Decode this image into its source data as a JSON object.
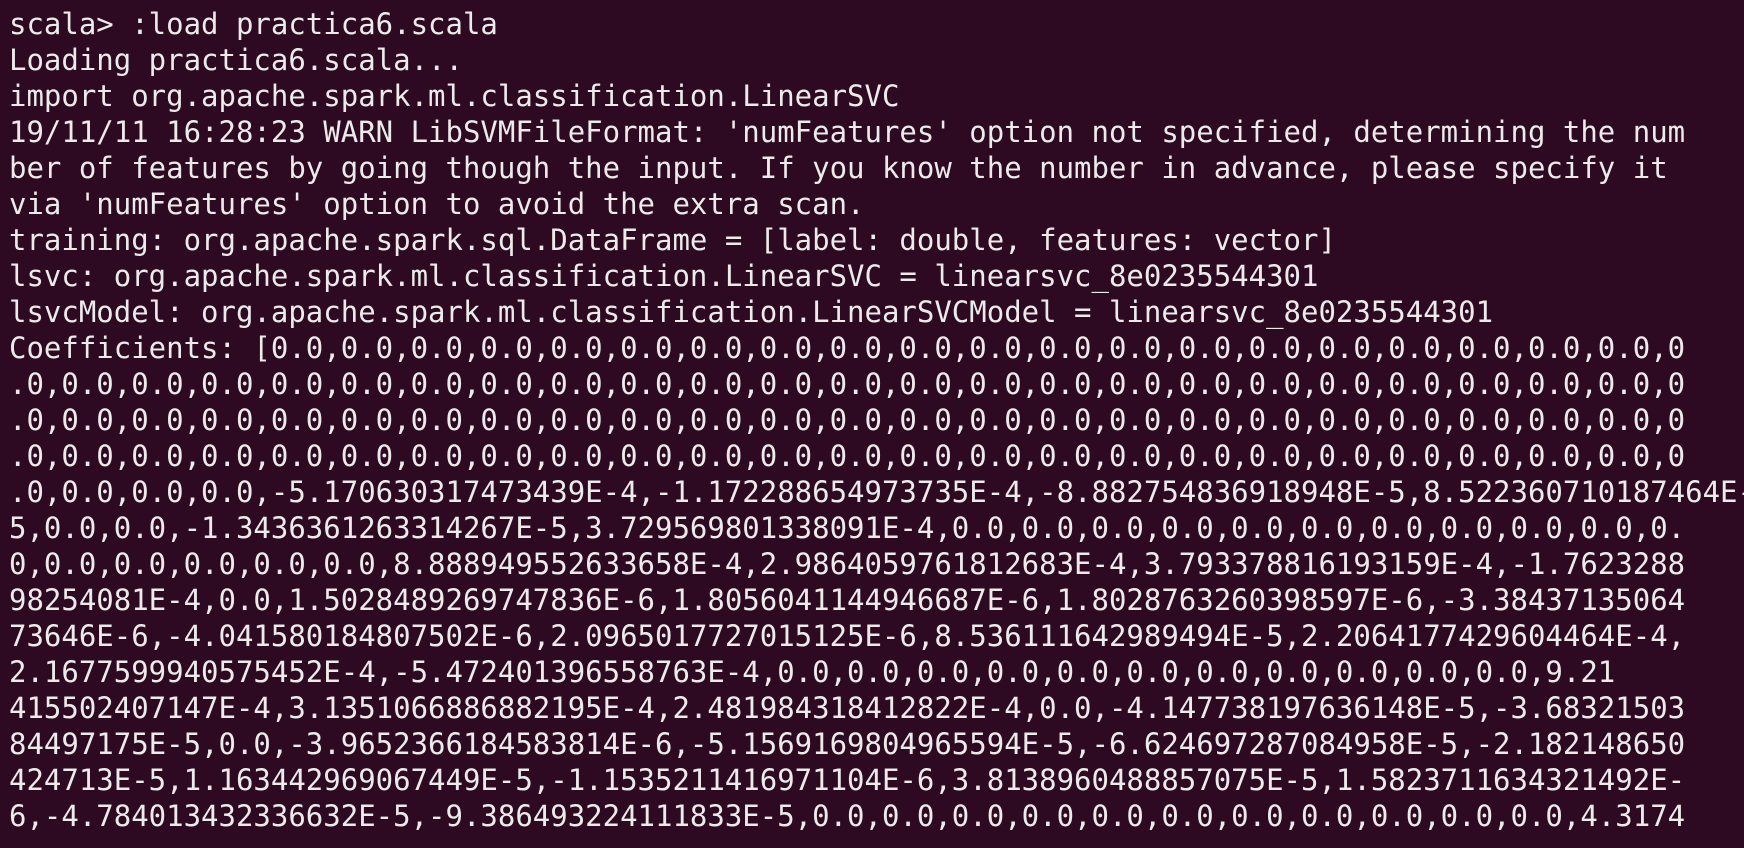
{
  "terminal": {
    "lines": [
      "scala> :load practica6.scala",
      "Loading practica6.scala...",
      "import org.apache.spark.ml.classification.LinearSVC",
      "19/11/11 16:28:23 WARN LibSVMFileFormat: 'numFeatures' option not specified, determining the num",
      "ber of features by going though the input. If you know the number in advance, please specify it",
      "via 'numFeatures' option to avoid the extra scan.",
      "training: org.apache.spark.sql.DataFrame = [label: double, features: vector]",
      "lsvc: org.apache.spark.ml.classification.LinearSVC = linearsvc_8e0235544301",
      "lsvcModel: org.apache.spark.ml.classification.LinearSVCModel = linearsvc_8e0235544301",
      "Coefficients: [0.0,0.0,0.0,0.0,0.0,0.0,0.0,0.0,0.0,0.0,0.0,0.0,0.0,0.0,0.0,0.0,0.0,0.0,0.0,0.0,0",
      ".0,0.0,0.0,0.0,0.0,0.0,0.0,0.0,0.0,0.0,0.0,0.0,0.0,0.0,0.0,0.0,0.0,0.0,0.0,0.0,0.0,0.0,0.0,0.0,0",
      ".0,0.0,0.0,0.0,0.0,0.0,0.0,0.0,0.0,0.0,0.0,0.0,0.0,0.0,0.0,0.0,0.0,0.0,0.0,0.0,0.0,0.0,0.0,0.0,0",
      ".0,0.0,0.0,0.0,0.0,0.0,0.0,0.0,0.0,0.0,0.0,0.0,0.0,0.0,0.0,0.0,0.0,0.0,0.0,0.0,0.0,0.0,0.0,0.0,0",
      ".0,0.0,0.0,0.0,-5.170630317473439E-4,-1.172288654973735E-4,-8.882754836918948E-5,8.522360710187464E-",
      "5,0.0,0.0,-1.3436361263314267E-5,3.729569801338091E-4,0.0,0.0,0.0,0.0,0.0,0.0,0.0,0.0,0.0,0.0,0.",
      "0,0.0,0.0,0.0,0.0,0.0,8.888949552633658E-4,2.9864059761812683E-4,3.793378816193159E-4,-1.7623288",
      "98254081E-4,0.0,1.5028489269747836E-6,1.8056041144946687E-6,1.8028763260398597E-6,-3.38437135064",
      "73646E-6,-4.041580184807502E-6,2.0965017727015125E-6,8.536111642989494E-5,2.2064177429604464E-4,",
      "2.1677599940575452E-4,-5.472401396558763E-4,0.0,0.0,0.0,0.0,0.0,0.0,0.0,0.0,0.0,0.0,0.0,9.21",
      "415502407147E-4,3.1351066886882195E-4,2.481984318412822E-4,0.0,-4.147738197636148E-5,-3.68321503",
      "84497175E-5,0.0,-3.9652366184583814E-6,-5.1569169804965594E-5,-6.624697287084958E-5,-2.182148650",
      "424713E-5,1.163442969067449E-5,-1.1535211416971104E-6,3.8138960488857075E-5,1.5823711634321492E-",
      "6,-4.784013432336632E-5,-9.386493224111833E-5,0.0,0.0,0.0,0.0,0.0,0.0,0.0,0.0,0.0,0.0,0.0,4.3174"
    ]
  }
}
